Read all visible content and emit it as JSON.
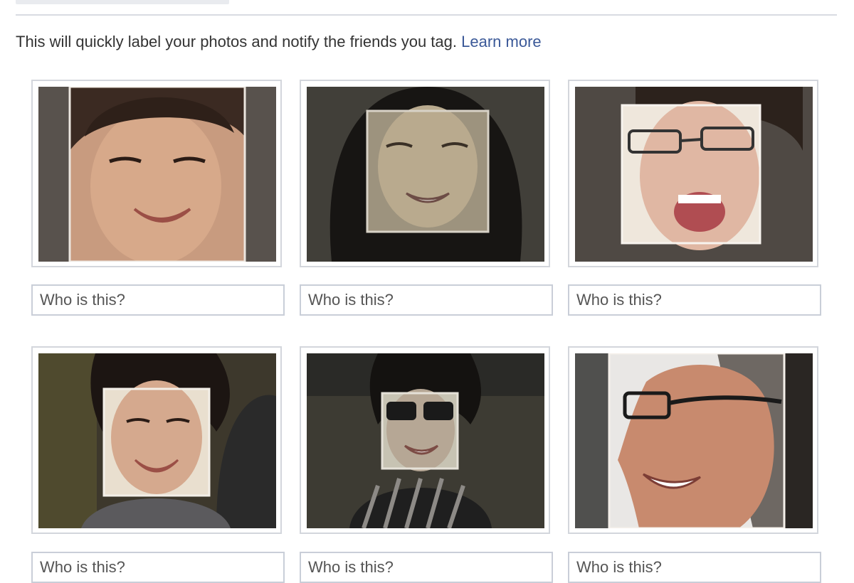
{
  "intro": {
    "text": "This will quickly label your photos and notify the friends you tag.",
    "learn_more": "Learn more"
  },
  "photos": [
    {
      "icon": "face-photo-woman-smiling",
      "input_placeholder": "Who is this?"
    },
    {
      "icon": "face-photo-woman-dark-hair",
      "input_placeholder": "Who is this?"
    },
    {
      "icon": "face-photo-man-glasses-laughing",
      "input_placeholder": "Who is this?"
    },
    {
      "icon": "face-photo-woman-smiling-outdoors",
      "input_placeholder": "Who is this?"
    },
    {
      "icon": "face-photo-woman-sunglasses",
      "input_placeholder": "Who is this?"
    },
    {
      "icon": "face-photo-man-glasses-profile",
      "input_placeholder": "Who is this?"
    }
  ],
  "colors": {
    "link": "#3b5998",
    "border": "#d3d6dc",
    "face_highlight": "#f1ece4"
  }
}
